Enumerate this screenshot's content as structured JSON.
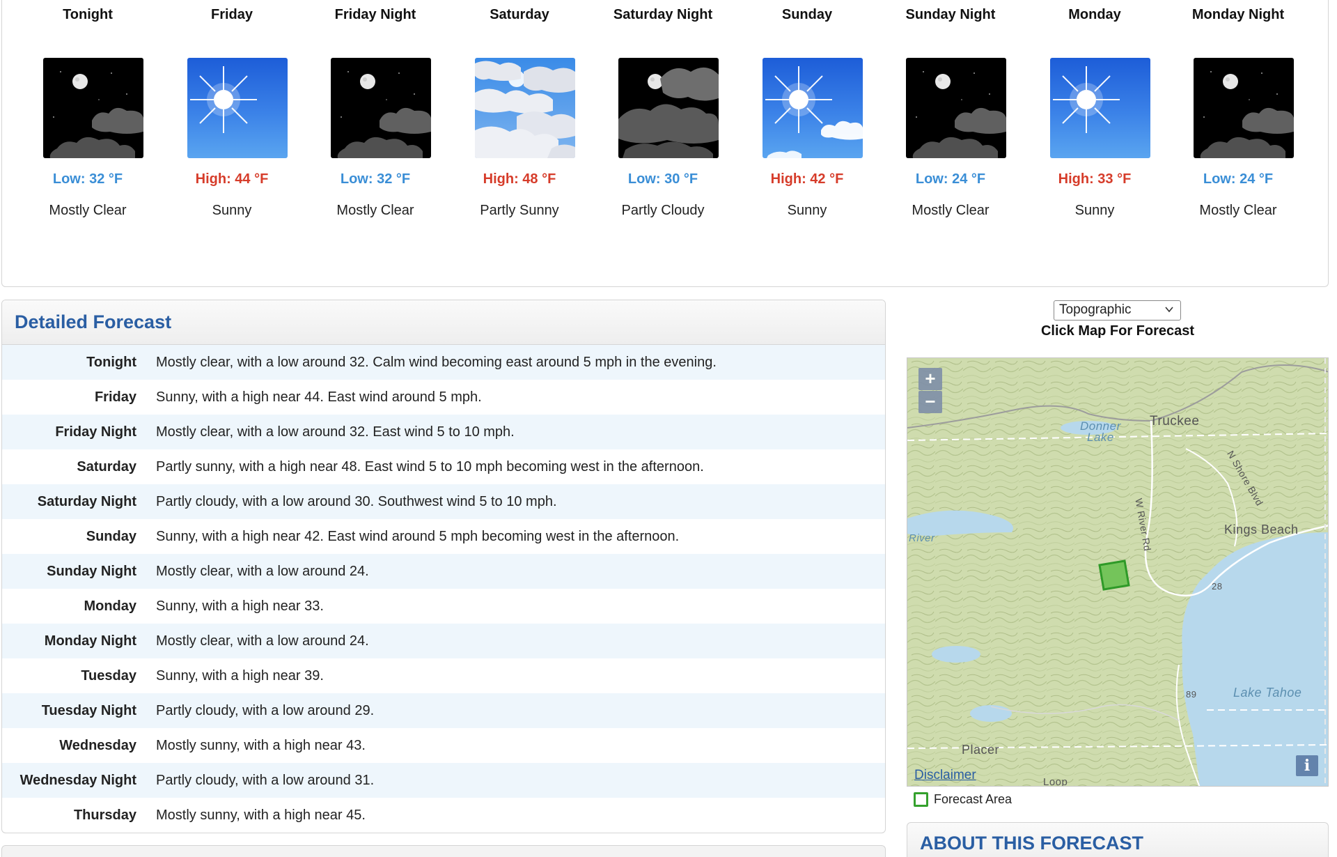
{
  "periods": [
    {
      "name": "Tonight",
      "icon": "moon-clouds-icon",
      "temp_type": "low",
      "temp": "Low: 32 °F",
      "condition": "Mostly Clear"
    },
    {
      "name": "Friday",
      "icon": "sun-icon",
      "temp_type": "high",
      "temp": "High: 44 °F",
      "condition": "Sunny"
    },
    {
      "name": "Friday Night",
      "icon": "moon-clouds-icon",
      "temp_type": "low",
      "temp": "Low: 32 °F",
      "condition": "Mostly Clear"
    },
    {
      "name": "Saturday",
      "icon": "sun-clouds-icon",
      "temp_type": "high",
      "temp": "High: 48 °F",
      "condition": "Partly Sunny"
    },
    {
      "name": "Saturday Night",
      "icon": "moon-cloudy-icon",
      "temp_type": "low",
      "temp": "Low: 30 °F",
      "condition": "Partly Cloudy"
    },
    {
      "name": "Sunday",
      "icon": "sun-small-cloud-icon",
      "temp_type": "high",
      "temp": "High: 42 °F",
      "condition": "Sunny"
    },
    {
      "name": "Sunday Night",
      "icon": "moon-clouds-icon",
      "temp_type": "low",
      "temp": "Low: 24 °F",
      "condition": "Mostly Clear"
    },
    {
      "name": "Monday",
      "icon": "sun-icon",
      "temp_type": "high",
      "temp": "High: 33 °F",
      "condition": "Sunny"
    },
    {
      "name": "Monday Night",
      "icon": "moon-clouds-icon",
      "temp_type": "low",
      "temp": "Low: 24 °F",
      "condition": "Mostly Clear"
    }
  ],
  "detailed": {
    "title": "Detailed Forecast",
    "rows": [
      {
        "label": "Tonight",
        "text": "Mostly clear, with a low around 32. Calm wind becoming east around 5 mph in the evening."
      },
      {
        "label": "Friday",
        "text": "Sunny, with a high near 44. East wind around 5 mph."
      },
      {
        "label": "Friday Night",
        "text": "Mostly clear, with a low around 32. East wind 5 to 10 mph."
      },
      {
        "label": "Saturday",
        "text": "Partly sunny, with a high near 48. East wind 5 to 10 mph becoming west in the afternoon."
      },
      {
        "label": "Saturday Night",
        "text": "Partly cloudy, with a low around 30. Southwest wind 5 to 10 mph."
      },
      {
        "label": "Sunday",
        "text": "Sunny, with a high near 42. East wind around 5 mph becoming west in the afternoon."
      },
      {
        "label": "Sunday Night",
        "text": "Mostly clear, with a low around 24."
      },
      {
        "label": "Monday",
        "text": "Sunny, with a high near 33."
      },
      {
        "label": "Monday Night",
        "text": "Mostly clear, with a low around 24."
      },
      {
        "label": "Tuesday",
        "text": "Sunny, with a high near 39."
      },
      {
        "label": "Tuesday Night",
        "text": "Partly cloudy, with a low around 29."
      },
      {
        "label": "Wednesday",
        "text": "Mostly sunny, with a high near 43."
      },
      {
        "label": "Wednesday Night",
        "text": "Partly cloudy, with a low around 31."
      },
      {
        "label": "Thursday",
        "text": "Mostly sunny, with a high near 45."
      }
    ]
  },
  "map": {
    "layer_select": "Topographic",
    "caption": "Click Map For Forecast",
    "zoom_in": "+",
    "zoom_out": "−",
    "labels": {
      "truckee": "Truckee",
      "donner_lake_1": "Donner",
      "donner_lake_2": "Lake",
      "kings_beach": "Kings Beach",
      "lake_tahoe": "Lake Tahoe",
      "placer": "Placer",
      "river": "River",
      "w_river_rd": "W River Rd",
      "n_shore_blvd": "N Shore Blvd",
      "hwy_28": "28",
      "hwy_89": "89",
      "loop": "Loop"
    },
    "disclaimer": "Disclaimer",
    "info": "i",
    "legend": "Forecast Area"
  },
  "about": {
    "title": "ABOUT THIS FORECAST"
  },
  "colors": {
    "low": "#3a8ed6",
    "high": "#d63c2a",
    "heading": "#2a5ea3",
    "forecast_area": "#35a12d"
  }
}
